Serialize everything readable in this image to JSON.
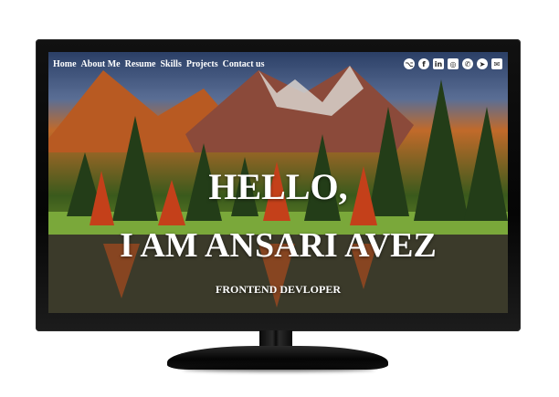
{
  "nav": {
    "items": [
      {
        "label": "Home"
      },
      {
        "label": "About Me"
      },
      {
        "label": "Resume"
      },
      {
        "label": "Skills"
      },
      {
        "label": "Projects"
      },
      {
        "label": "Contact us"
      }
    ]
  },
  "socials": [
    {
      "icon": "github-icon",
      "glyph": "⌥"
    },
    {
      "icon": "facebook-icon",
      "glyph": "f"
    },
    {
      "icon": "linkedin-icon",
      "glyph": "in"
    },
    {
      "icon": "instagram-icon",
      "glyph": "◎"
    },
    {
      "icon": "whatsapp-icon",
      "glyph": "✆"
    },
    {
      "icon": "telegram-icon",
      "glyph": "➤"
    },
    {
      "icon": "email-icon",
      "glyph": "✉"
    }
  ],
  "hero": {
    "line1": "HELLO,",
    "line2": "I AM ANSARI AVEZ",
    "role": "FRONTEND DEVLOPER"
  }
}
